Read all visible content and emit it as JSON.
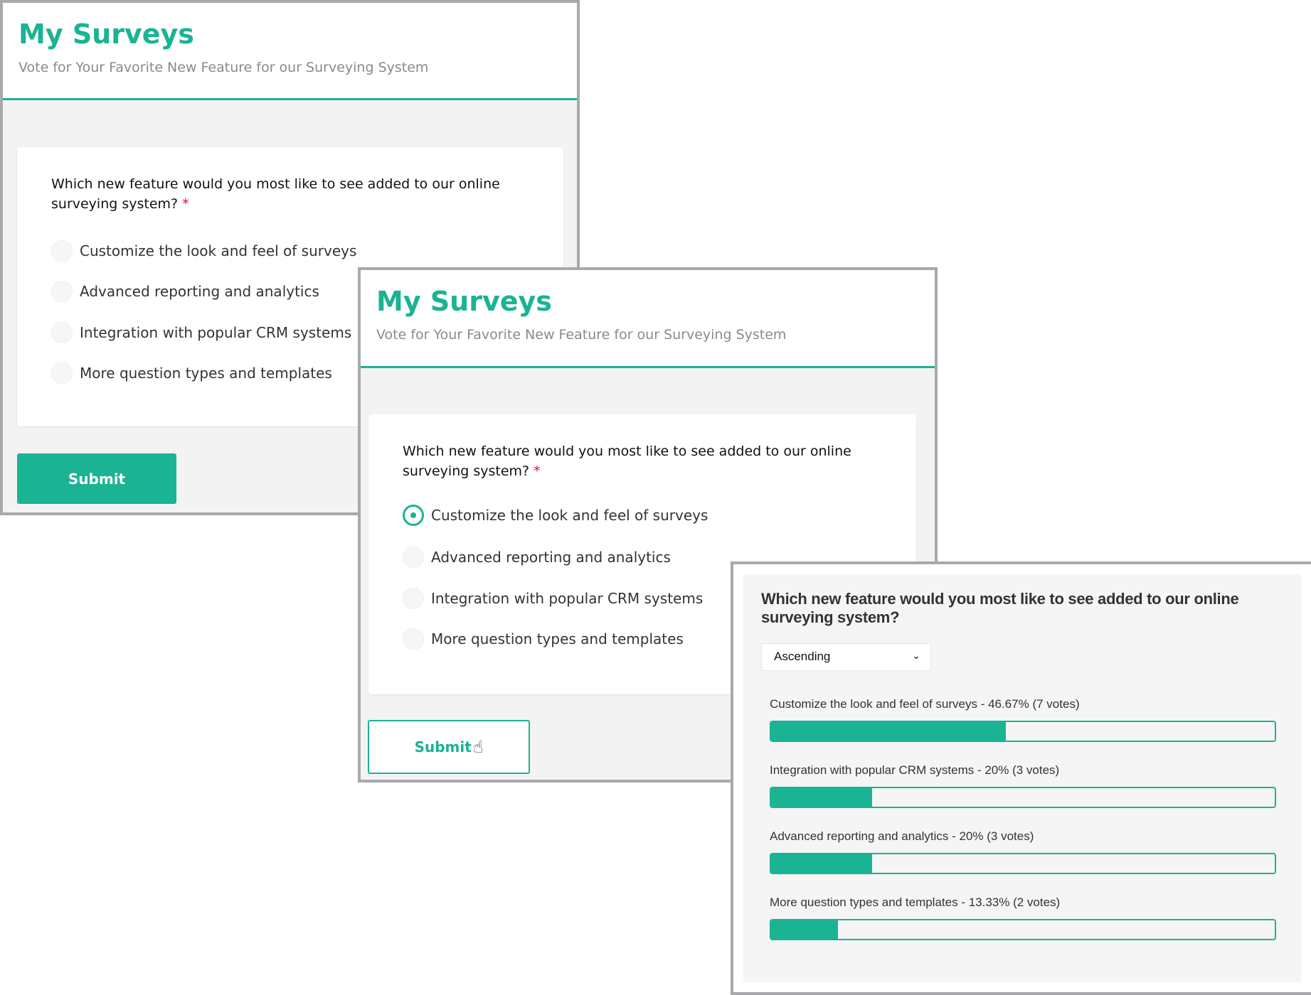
{
  "survey": {
    "title": "My Surveys",
    "subtitle": "Vote for Your Favorite New Feature for our Surveying System",
    "question": "Which new feature would you most like to see added to our online surveying system?",
    "required_mark": "*",
    "options": [
      "Customize the look and feel of surveys",
      "Advanced reporting and analytics",
      "Integration with popular CRM systems",
      "More question types and templates"
    ],
    "submit_label": "Submit",
    "selected_option_in_second_view": 0
  },
  "results": {
    "question": "Which new feature would you most like to see added to our online surveying system?",
    "sort_select": "Ascending",
    "items": [
      {
        "label": "Customize the look and feel of surveys - 46.67% (7 votes)",
        "percent": 46.67
      },
      {
        "label": "Integration with popular CRM systems - 20% (3 votes)",
        "percent": 20
      },
      {
        "label": "Advanced reporting and analytics - 20% (3 votes)",
        "percent": 20
      },
      {
        "label": "More question types and templates - 13.33% (2 votes)",
        "percent": 13.33
      }
    ]
  },
  "colors": {
    "accent": "#1ab394",
    "required": "#e60a3e"
  }
}
